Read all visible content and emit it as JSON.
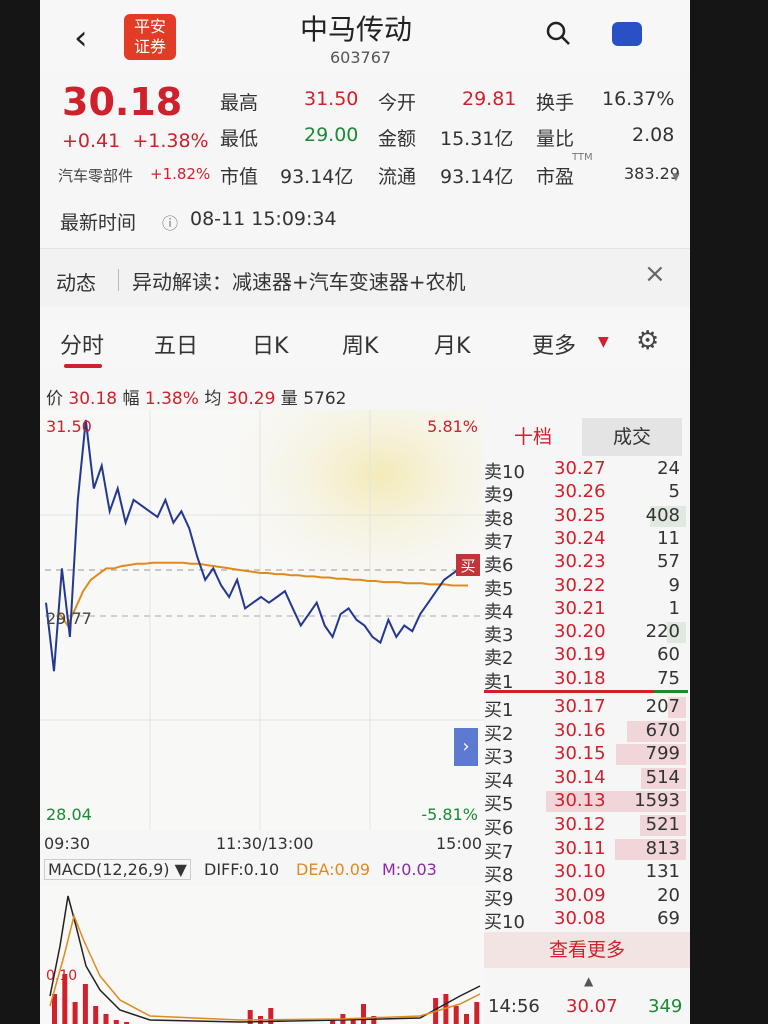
{
  "header": {
    "back": "‹",
    "logo_line1": "平安",
    "logo_line2": "证券",
    "title": "中马传动",
    "code": "603767"
  },
  "quote": {
    "price": "30.18",
    "change": "+0.41",
    "change_pct": "+1.38%",
    "sector": "汽车零部件",
    "sector_pct": "+1.82%",
    "high_label": "最高",
    "high": "31.50",
    "open_label": "今开",
    "open": "29.81",
    "turnover_label": "换手",
    "turnover": "16.37%",
    "low_label": "最低",
    "low": "29.00",
    "amount_label": "金额",
    "amount": "15.31亿",
    "volratio_label": "量比",
    "volratio": "2.08",
    "mktcap_label": "市值",
    "mktcap": "93.14亿",
    "float_label": "流通",
    "float": "93.14亿",
    "pe_label": "市盈",
    "pe_sup": "TTM",
    "pe": "383.29"
  },
  "latest": {
    "label": "最新时间",
    "value": "08-11 15:09:34"
  },
  "dynamic": {
    "label": "动态",
    "text": "异动解读：减速器+汽车变速器+农机",
    "close": "×"
  },
  "tabs": [
    "分时",
    "五日",
    "日K",
    "周K",
    "月K",
    "更多"
  ],
  "chart_info": {
    "price_label": "价",
    "price": "30.18",
    "amp_label": "幅",
    "amp": "1.38%",
    "avg_label": "均",
    "avg": "30.29",
    "vol_label": "量",
    "vol": "5762"
  },
  "chart_data": {
    "type": "line",
    "ymax_label": "31.50",
    "ymid_label": "29.77",
    "ymin_label": "28.04",
    "pct_top": "5.81%",
    "pct_bottom": "-5.81%",
    "x_labels": [
      "09:30",
      "11:30/13:00",
      "15:00"
    ],
    "ylim": [
      28.04,
      31.5
    ],
    "prev_close": 29.77,
    "series": [
      {
        "values": [
          29.9,
          29.3,
          30.2,
          29.6,
          30.8,
          31.5,
          30.9,
          31.1,
          30.7,
          30.9,
          30.6,
          30.8,
          30.75,
          30.7,
          30.65,
          30.8,
          30.6,
          30.7,
          30.55,
          30.3,
          30.1,
          30.2,
          30.05,
          29.95,
          30.1,
          29.85,
          29.9,
          29.95,
          29.9,
          29.95,
          30.0,
          29.85,
          29.7,
          29.8,
          29.9,
          29.7,
          29.6,
          29.8,
          29.85,
          29.75,
          29.7,
          29.6,
          29.55,
          29.75,
          29.6,
          29.7,
          29.65,
          29.8,
          29.9,
          30.0,
          30.1,
          30.15,
          30.2,
          30.18
        ]
      },
      {
        "values": [
          29.8,
          29.7,
          29.85,
          30.0,
          30.1,
          30.15,
          30.2,
          30.2,
          30.22,
          30.23,
          30.24,
          30.24,
          30.25,
          30.25,
          30.25,
          30.25,
          30.25,
          30.24,
          30.24,
          30.23,
          30.22,
          30.21,
          30.2,
          30.19,
          30.18,
          30.17,
          30.16,
          30.16,
          30.15,
          30.15,
          30.14,
          30.14,
          30.13,
          30.13,
          30.12,
          30.12,
          30.11,
          30.11,
          30.1,
          30.1,
          30.09,
          30.09,
          30.08,
          30.08,
          30.08,
          30.07,
          30.07,
          30.07,
          30.06,
          30.06,
          30.06,
          30.05,
          30.05,
          30.05
        ]
      }
    ]
  },
  "macd": {
    "label": "MACD(12,26,9) ▼",
    "diff": "DIFF:0.10",
    "dea": "DEA:0.09",
    "m": "M:0.03",
    "axis": "0.10"
  },
  "book": {
    "tab_ten": "十档",
    "tab_trade": "成交",
    "asks": [
      {
        "label": "卖10",
        "price": "30.27",
        "vol": "24"
      },
      {
        "label": "卖9",
        "price": "30.26",
        "vol": "5"
      },
      {
        "label": "卖8",
        "price": "30.25",
        "vol": "408"
      },
      {
        "label": "卖7",
        "price": "30.24",
        "vol": "11"
      },
      {
        "label": "卖6",
        "price": "30.23",
        "vol": "57"
      },
      {
        "label": "卖5",
        "price": "30.22",
        "vol": "9"
      },
      {
        "label": "卖4",
        "price": "30.21",
        "vol": "1"
      },
      {
        "label": "卖3",
        "price": "30.20",
        "vol": "220"
      },
      {
        "label": "卖2",
        "price": "30.19",
        "vol": "60"
      },
      {
        "label": "卖1",
        "price": "30.18",
        "vol": "75"
      }
    ],
    "bids": [
      {
        "label": "买1",
        "price": "30.17",
        "vol": "207"
      },
      {
        "label": "买2",
        "price": "30.16",
        "vol": "670"
      },
      {
        "label": "买3",
        "price": "30.15",
        "vol": "799"
      },
      {
        "label": "买4",
        "price": "30.14",
        "vol": "514"
      },
      {
        "label": "买5",
        "price": "30.13",
        "vol": "1593"
      },
      {
        "label": "买6",
        "price": "30.12",
        "vol": "521"
      },
      {
        "label": "买7",
        "price": "30.11",
        "vol": "813"
      },
      {
        "label": "买8",
        "price": "30.10",
        "vol": "131"
      },
      {
        "label": "买9",
        "price": "30.09",
        "vol": "20"
      },
      {
        "label": "买10",
        "price": "30.08",
        "vol": "69"
      }
    ],
    "more": "查看更多",
    "last_trade": {
      "time": "14:56",
      "price": "30.07",
      "vol": "349"
    }
  },
  "buy_tag": "买",
  "expand": "›"
}
